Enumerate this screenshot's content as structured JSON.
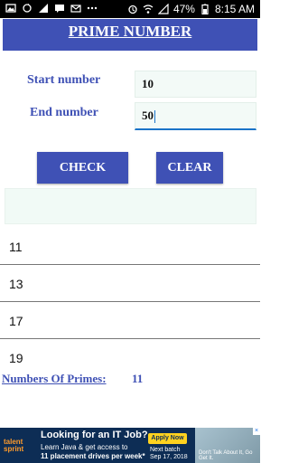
{
  "status_bar": {
    "battery_percent": "47%",
    "time": "8:15 AM"
  },
  "app": {
    "title": "PRIME NUMBER"
  },
  "form": {
    "start_label": "Start number",
    "start_value": "10",
    "end_label": "End number",
    "end_value": "50"
  },
  "buttons": {
    "check": "CHECK",
    "clear": "CLEAR"
  },
  "results": {
    "items": [
      "11",
      "13",
      "17",
      "19"
    ],
    "count_label": "Numbers Of Primes:",
    "count_value": "11"
  },
  "ad": {
    "brand": "talent sprint",
    "headline": "Looking for an IT Job?",
    "line1": "Learn Java & get access to",
    "line2": "11 placement drives per week*",
    "apply": "Apply Now",
    "batch_label": "Next batch",
    "batch_date": "Sep 17, 2018",
    "photo_caption": "Don't Talk About It, Go Get It."
  },
  "colors": {
    "primary": "#3f51b5",
    "field_bg": "#f3faf7",
    "ad_bg": "#0d2d55"
  }
}
